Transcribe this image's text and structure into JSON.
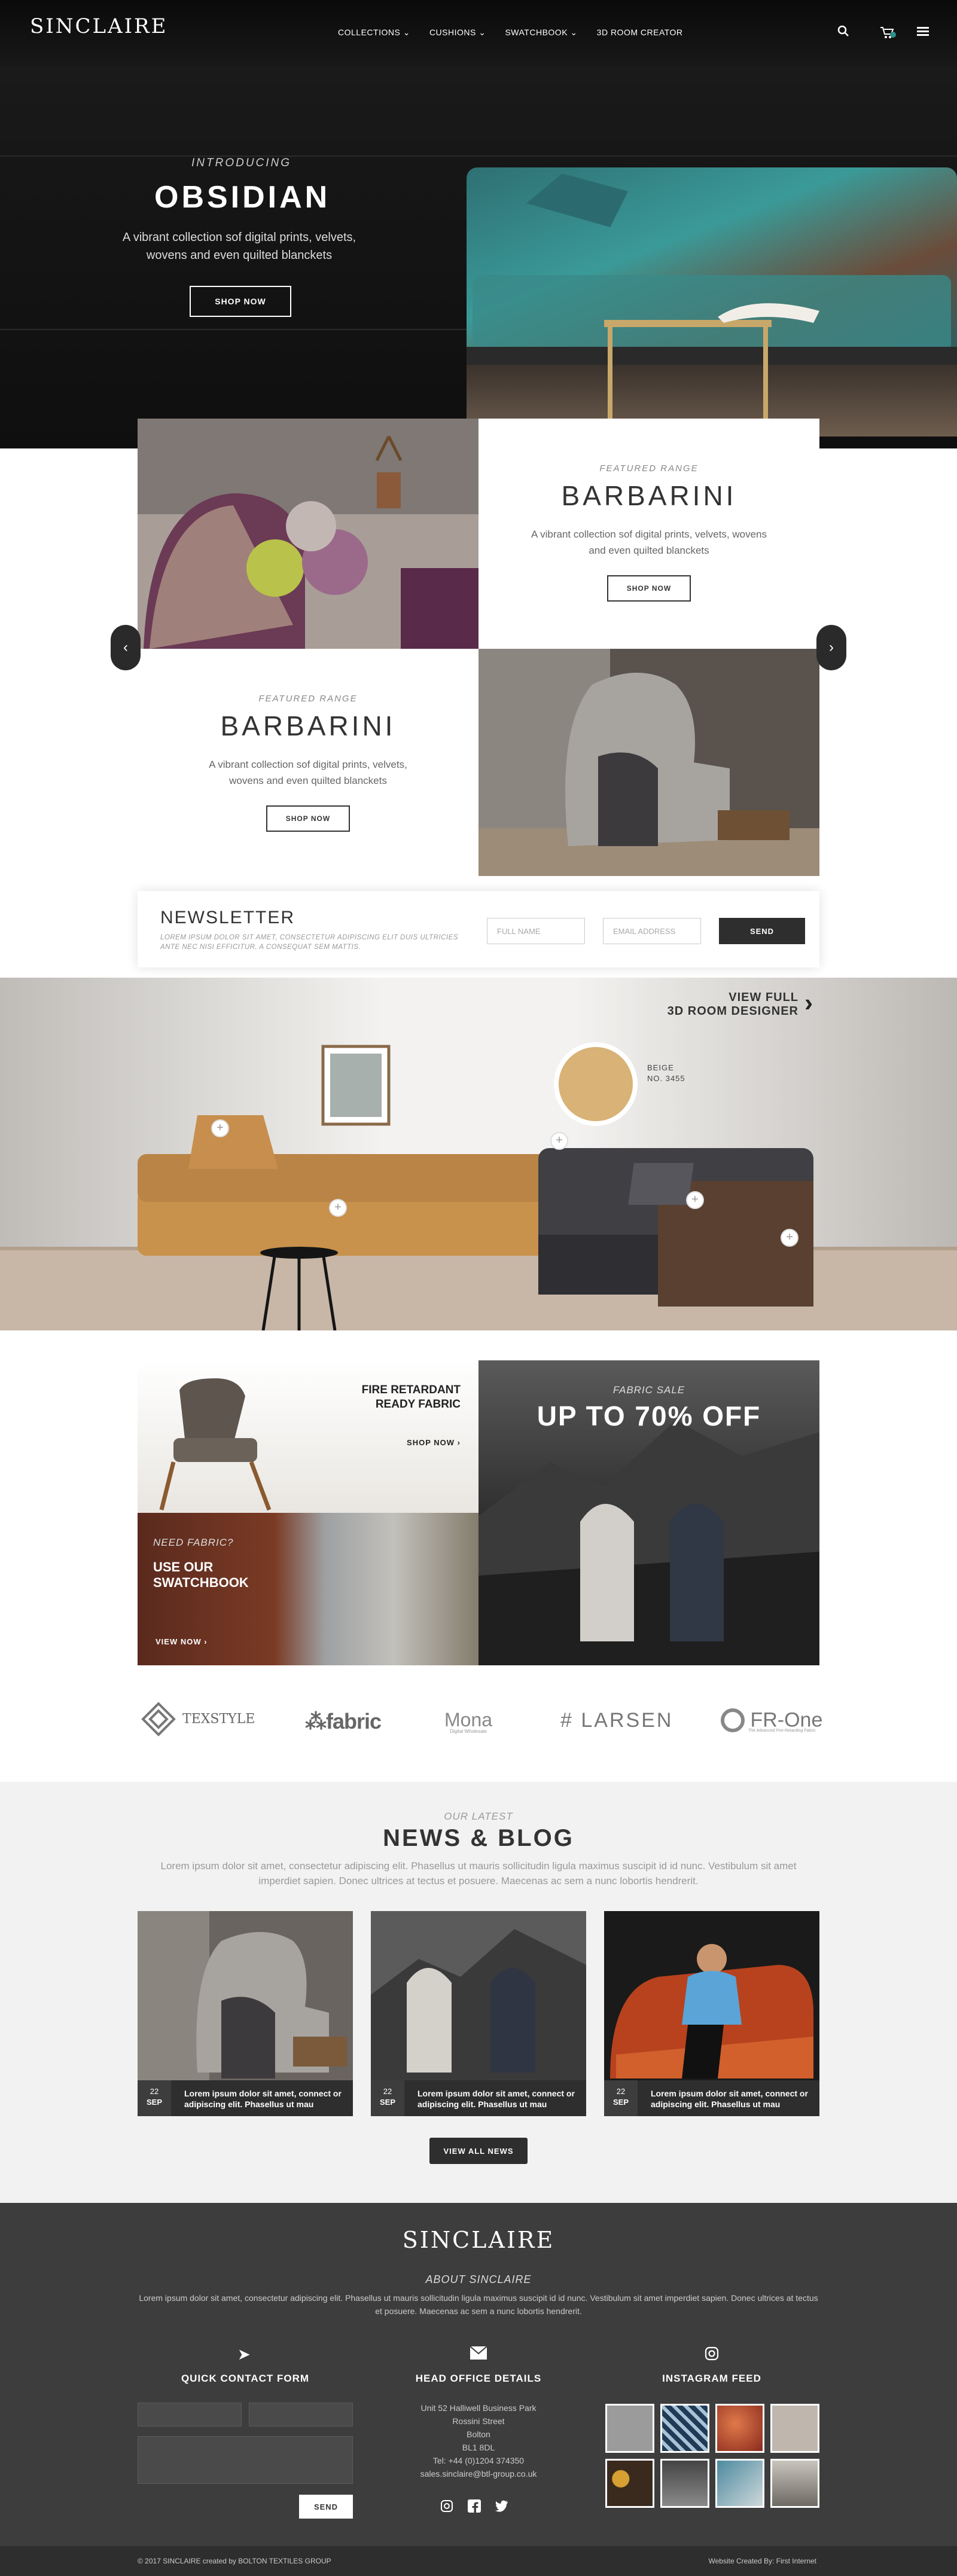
{
  "header": {
    "logo": "SINCLAIRE",
    "nav": [
      "COLLECTIONS",
      "CUSHIONS",
      "SWATCHBOOK",
      "3D ROOM CREATOR"
    ]
  },
  "hero": {
    "kicker": "INTRODUCING",
    "title": "OBSIDIAN",
    "description": "A vibrant collection sof digital prints, velvets, wovens and even quilted blanckets",
    "button": "SHOP NOW"
  },
  "featured": [
    {
      "kicker": "FEATURED RANGE",
      "title": "BARBARINI",
      "description": "A vibrant collection sof digital prints, velvets, wovens and even quilted blanckets",
      "button": "SHOP NOW"
    },
    {
      "kicker": "FEATURED RANGE",
      "title": "BARBARINI",
      "description": "A vibrant collection sof digital prints, velvets, wovens and even quilted blanckets",
      "button": "SHOP NOW"
    }
  ],
  "newsletter": {
    "title": "NEWSLETTER",
    "text": "LOREM IPSUM DOLOR SIT AMET, CONSECTETUR ADIPISCING ELIT DUIS ULTRICIES ANTE NEC NISI EFFICITUR, A CONSEQUAT SEM MATTIS.",
    "name_placeholder": "FULL NAME",
    "email_placeholder": "EMAIL ADDRESS",
    "button": "SEND"
  },
  "room": {
    "link_line1": "VIEW FULL",
    "link_line2": "3D ROOM DESIGNER",
    "swatch_name": "BEIGE",
    "swatch_no": "NO. 3455"
  },
  "promo": {
    "fire_title": "FIRE RETARDANT READY FABRIC",
    "fire_button": "SHOP NOW",
    "sale_kicker": "FABRIC SALE",
    "sale_title": "UP TO 70% OFF",
    "swatch_kicker": "NEED FABRIC?",
    "swatch_title": "USE OUR SWATCHBOOK",
    "swatch_button": "VIEW NOW"
  },
  "brands": [
    "TEXSTYLE",
    "fabric",
    "Mona",
    "LARSEN",
    "FR-One"
  ],
  "brand_sub": {
    "mona": "Digital Wholesale",
    "frone": "The Advanced Fire-Retarding Fabric"
  },
  "blog": {
    "kicker": "OUR LATEST",
    "title": "NEWS & BLOG",
    "text": "Lorem ipsum dolor sit amet, consectetur adipiscing elit. Phasellus ut mauris sollicitudin ligula maximus suscipit id id nunc. Vestibulum sit amet imperdiet sapien. Donec ultrices at tectus et posuere. Maecenas ac sem a nunc lobortis hendrerit.",
    "posts": [
      {
        "day": "22",
        "month": "SEP",
        "text": "Lorem ipsum dolor sit amet, connect or adipiscing elit. Phasellus ut mau"
      },
      {
        "day": "22",
        "month": "SEP",
        "text": "Lorem ipsum dolor sit amet, connect or adipiscing elit. Phasellus ut mau"
      },
      {
        "day": "22",
        "month": "SEP",
        "text": "Lorem ipsum dolor sit amet, connect or adipiscing elit. Phasellus ut mau"
      }
    ],
    "button": "VIEW ALL NEWS"
  },
  "footer": {
    "logo": "SINCLAIRE",
    "about_title": "ABOUT SINCLAIRE",
    "about_text": "Lorem ipsum dolor sit amet, consectetur adipiscing elit. Phasellus ut mauris sollicitudin ligula maximus suscipit id id nunc. Vestibulum sit amet imperdiet sapien. Donec ultrices at tectus et posuere. Maecenas ac sem a nunc lobortis hendrerit.",
    "contact_title": "QUICK CONTACT FORM",
    "send": "SEND",
    "office_title": "HEAD OFFICE DETAILS",
    "address": [
      "Unit 52 Halliwell Business Park",
      "Rossini Street",
      "Bolton",
      "BL1 8DL",
      "Tel: +44 (0)1204 374350",
      "sales.sinclaire@btl-group.co.uk"
    ],
    "instagram_title": "INSTAGRAM FEED",
    "copyright": "© 2017 SINCLAIRE created by BOLTON TEXTILES GROUP",
    "credit": "Website Created By: First Internet"
  },
  "colors": {
    "dark": "#111111",
    "footer": "#3d3d3d",
    "accent_teal": "#2f8f8a",
    "button_dark": "#2e2e2e"
  }
}
